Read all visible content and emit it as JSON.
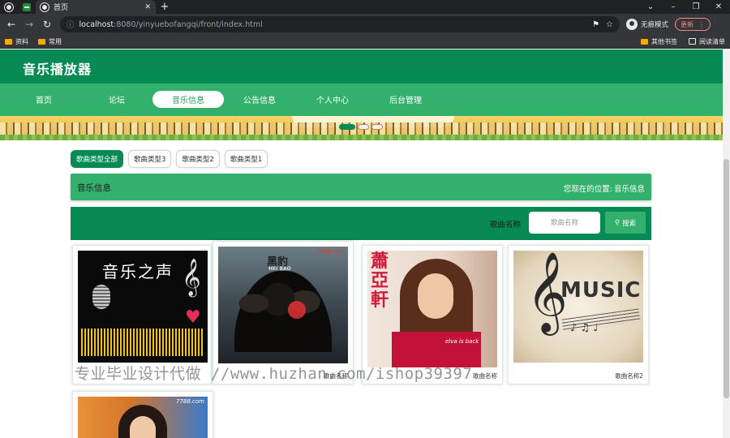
{
  "browser": {
    "active_tab_title": "首页",
    "url_host": "localhost",
    "url_rest": ":8080/yinyuebofangqi/front/index.html",
    "profile_label": "无痕模式",
    "update_label": "更新",
    "bookmarks": [
      "资料",
      "常用"
    ],
    "bookmarks_right": [
      "其他书签",
      "阅读清单"
    ]
  },
  "site": {
    "title": "音乐播放器",
    "nav": [
      "首页",
      "论坛",
      "音乐信息",
      "公告信息",
      "个人中心",
      "后台管理"
    ],
    "active_nav_index": 2
  },
  "categories": [
    "歌曲类型全部",
    "歌曲类型3",
    "歌曲类型2",
    "歌曲类型1"
  ],
  "breadcrumb": {
    "title": "音乐信息",
    "location_label": "您现在的位置:",
    "location_value": "音乐信息"
  },
  "search": {
    "label": "歌曲名称",
    "placeholder": "歌曲名称",
    "button": "搜索"
  },
  "songs": [
    {
      "name": "",
      "art_text": "音乐之声"
    },
    {
      "name": "歌曲名称",
      "art_text": "黑豹",
      "art_sub": "HEI BAO",
      "art_brand": "7788.com"
    },
    {
      "name": "歌曲名称",
      "art_text": "蕭亞軒",
      "art_sub": "elva is back"
    },
    {
      "name": "歌曲名称2",
      "art_text": "MUSIC"
    },
    {
      "name": "",
      "art_brand": "7788.com"
    }
  ],
  "watermark": "专业毕业设计代做 //www.huzhan.com/ishop39397",
  "colors": {
    "header": "#078a53",
    "nav": "#33b06c",
    "accent": "#078a53"
  }
}
